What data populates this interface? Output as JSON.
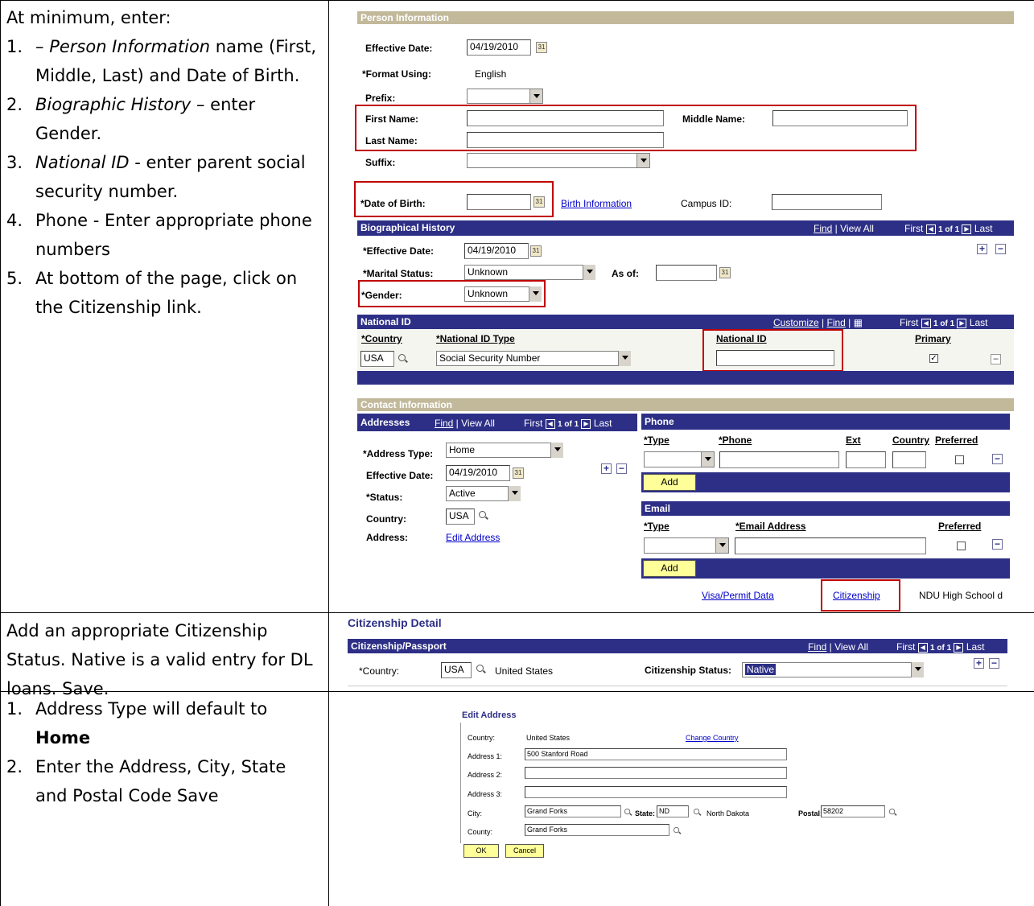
{
  "row1": {
    "intro": "At minimum, enter:",
    "steps": [
      {
        "num": "1.",
        "pre": "– ",
        "em": "Person Information",
        "post": " name (First, Middle, Last) and Date of Birth."
      },
      {
        "num": "2.",
        "pre": "",
        "em": "Biographic History",
        "post": " – enter Gender."
      },
      {
        "num": "3.",
        "pre": "",
        "em": "National ID",
        "post": " - enter parent social security number."
      },
      {
        "num": "4.",
        "pre": "",
        "em": "",
        "post": "Phone -  Enter appropriate phone numbers"
      },
      {
        "num": "5.",
        "pre": "",
        "em": "",
        "post": "At bottom of the page, click on the Citizenship link."
      }
    ]
  },
  "row2": {
    "text": "Add an appropriate Citizenship Status.  Native is a valid entry for DL loans.  Save."
  },
  "row3": {
    "steps": [
      {
        "num": "1.",
        "text": "Address Type will default to ",
        "bold": "Home"
      },
      {
        "num": "2.",
        "text": "Enter the Address, City, State and Postal Code Save",
        "bold": ""
      }
    ]
  },
  "person": {
    "header": "Person Information",
    "effective_date_label": "Effective Date:",
    "effective_date": "04/19/2010",
    "format_label": "*Format Using:",
    "format_value": "English",
    "prefix_label": "Prefix:",
    "first_name_label": "First Name:",
    "middle_name_label": "Middle Name:",
    "last_name_label": "Last Name:",
    "suffix_label": "Suffix:",
    "dob_label": "*Date of Birth:",
    "birth_info_link": "Birth Information",
    "campus_id_label": "Campus ID:"
  },
  "bio": {
    "header": "Biographical History",
    "find": "Find",
    "view_all": "View All",
    "nav": "First",
    "count": "1 of 1",
    "last": "Last",
    "effective_date_label": "*Effective Date:",
    "effective_date": "04/19/2010",
    "marital_label": "*Marital Status:",
    "marital_value": "Unknown",
    "as_of_label": "As of:",
    "gender_label": "*Gender:",
    "gender_value": "Unknown"
  },
  "natid": {
    "header": "National ID",
    "customize": "Customize",
    "find": "Find",
    "nav": "First",
    "count": "1 of 1",
    "last": "Last",
    "col_country": "*Country",
    "col_type": "*National ID Type",
    "col_id": "National ID",
    "col_primary": "Primary",
    "country": "USA",
    "type": "Social Security Number"
  },
  "contact": {
    "header": "Contact Information",
    "addr_header": "Addresses",
    "find": "Find",
    "view_all": "View All",
    "nav": "First",
    "count": "1 of 1",
    "last": "Last",
    "addr_type_label": "*Address Type:",
    "addr_type": "Home",
    "eff_date_label": "Effective Date:",
    "eff_date": "04/19/2010",
    "status_label": "*Status:",
    "status": "Active",
    "country_label": "Country:",
    "country": "USA",
    "address_label": "Address:",
    "edit_address": "Edit Address",
    "phone_header": "Phone",
    "phone_cols": {
      "type": "*Type",
      "phone": "*Phone",
      "ext": "Ext",
      "country": "Country",
      "preferred": "Preferred"
    },
    "add": "Add",
    "email_header": "Email",
    "email_cols": {
      "type": "*Type",
      "email": "*Email Address",
      "preferred": "Preferred"
    },
    "links": {
      "visa": "Visa/Permit Data",
      "citizenship": "Citizenship",
      "school": "NDU High School d"
    }
  },
  "citizenship": {
    "title": "Citizenship Detail",
    "header": "Citizenship/Passport",
    "find": "Find",
    "view_all": "View All",
    "nav": "First",
    "count": "1 of 1",
    "last": "Last",
    "country_label": "*Country:",
    "country": "USA",
    "country_name": "United States",
    "status_label": "Citizenship Status:",
    "status": "Native"
  },
  "edit_address": {
    "title": "Edit Address",
    "country_label": "Country:",
    "country": "United States",
    "change_country": "Change Country",
    "addr1_label": "Address 1:",
    "addr1": "500 Stanford Road",
    "addr2_label": "Address 2:",
    "addr3_label": "Address 3:",
    "city_label": "City:",
    "city": "Grand Forks",
    "state_label": "State:",
    "state": "ND",
    "state_name": "North Dakota",
    "postal_label": "Postal:",
    "postal": "58202",
    "county_label": "County:",
    "county": "Grand Forks",
    "ok": "OK",
    "cancel": "Cancel"
  }
}
